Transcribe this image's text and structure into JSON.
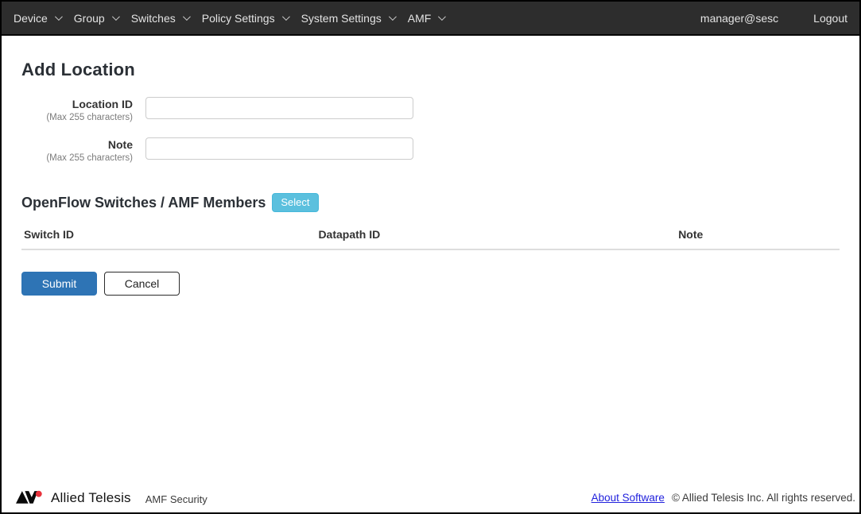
{
  "nav": {
    "items": [
      {
        "label": "Device"
      },
      {
        "label": "Group"
      },
      {
        "label": "Switches"
      },
      {
        "label": "Policy Settings"
      },
      {
        "label": "System Settings"
      },
      {
        "label": "AMF"
      }
    ],
    "user": "manager@sesc",
    "logout_label": "Logout"
  },
  "page": {
    "title": "Add Location"
  },
  "form": {
    "fields": [
      {
        "label": "Location ID",
        "hint": "(Max 255 characters)",
        "value": ""
      },
      {
        "label": "Note",
        "hint": "(Max 255 characters)",
        "value": ""
      }
    ]
  },
  "members_section": {
    "title": "OpenFlow Switches / AMF Members",
    "select_button": "Select",
    "table": {
      "columns": [
        "Switch ID",
        "Datapath ID",
        "Note"
      ],
      "rows": []
    }
  },
  "actions": {
    "submit": "Submit",
    "cancel": "Cancel"
  },
  "footer": {
    "brand": "Allied Telesis",
    "product": "AMF Security",
    "about_link": "About Software",
    "copyright": "© Allied Telesis Inc. All rights reserved."
  },
  "colors": {
    "navbar_bg": "#2d2d2d",
    "accent_blue": "#2e74b5",
    "select_blue": "#5bc0de",
    "link_blue": "#2222dd",
    "logo_red": "#e8323c"
  }
}
